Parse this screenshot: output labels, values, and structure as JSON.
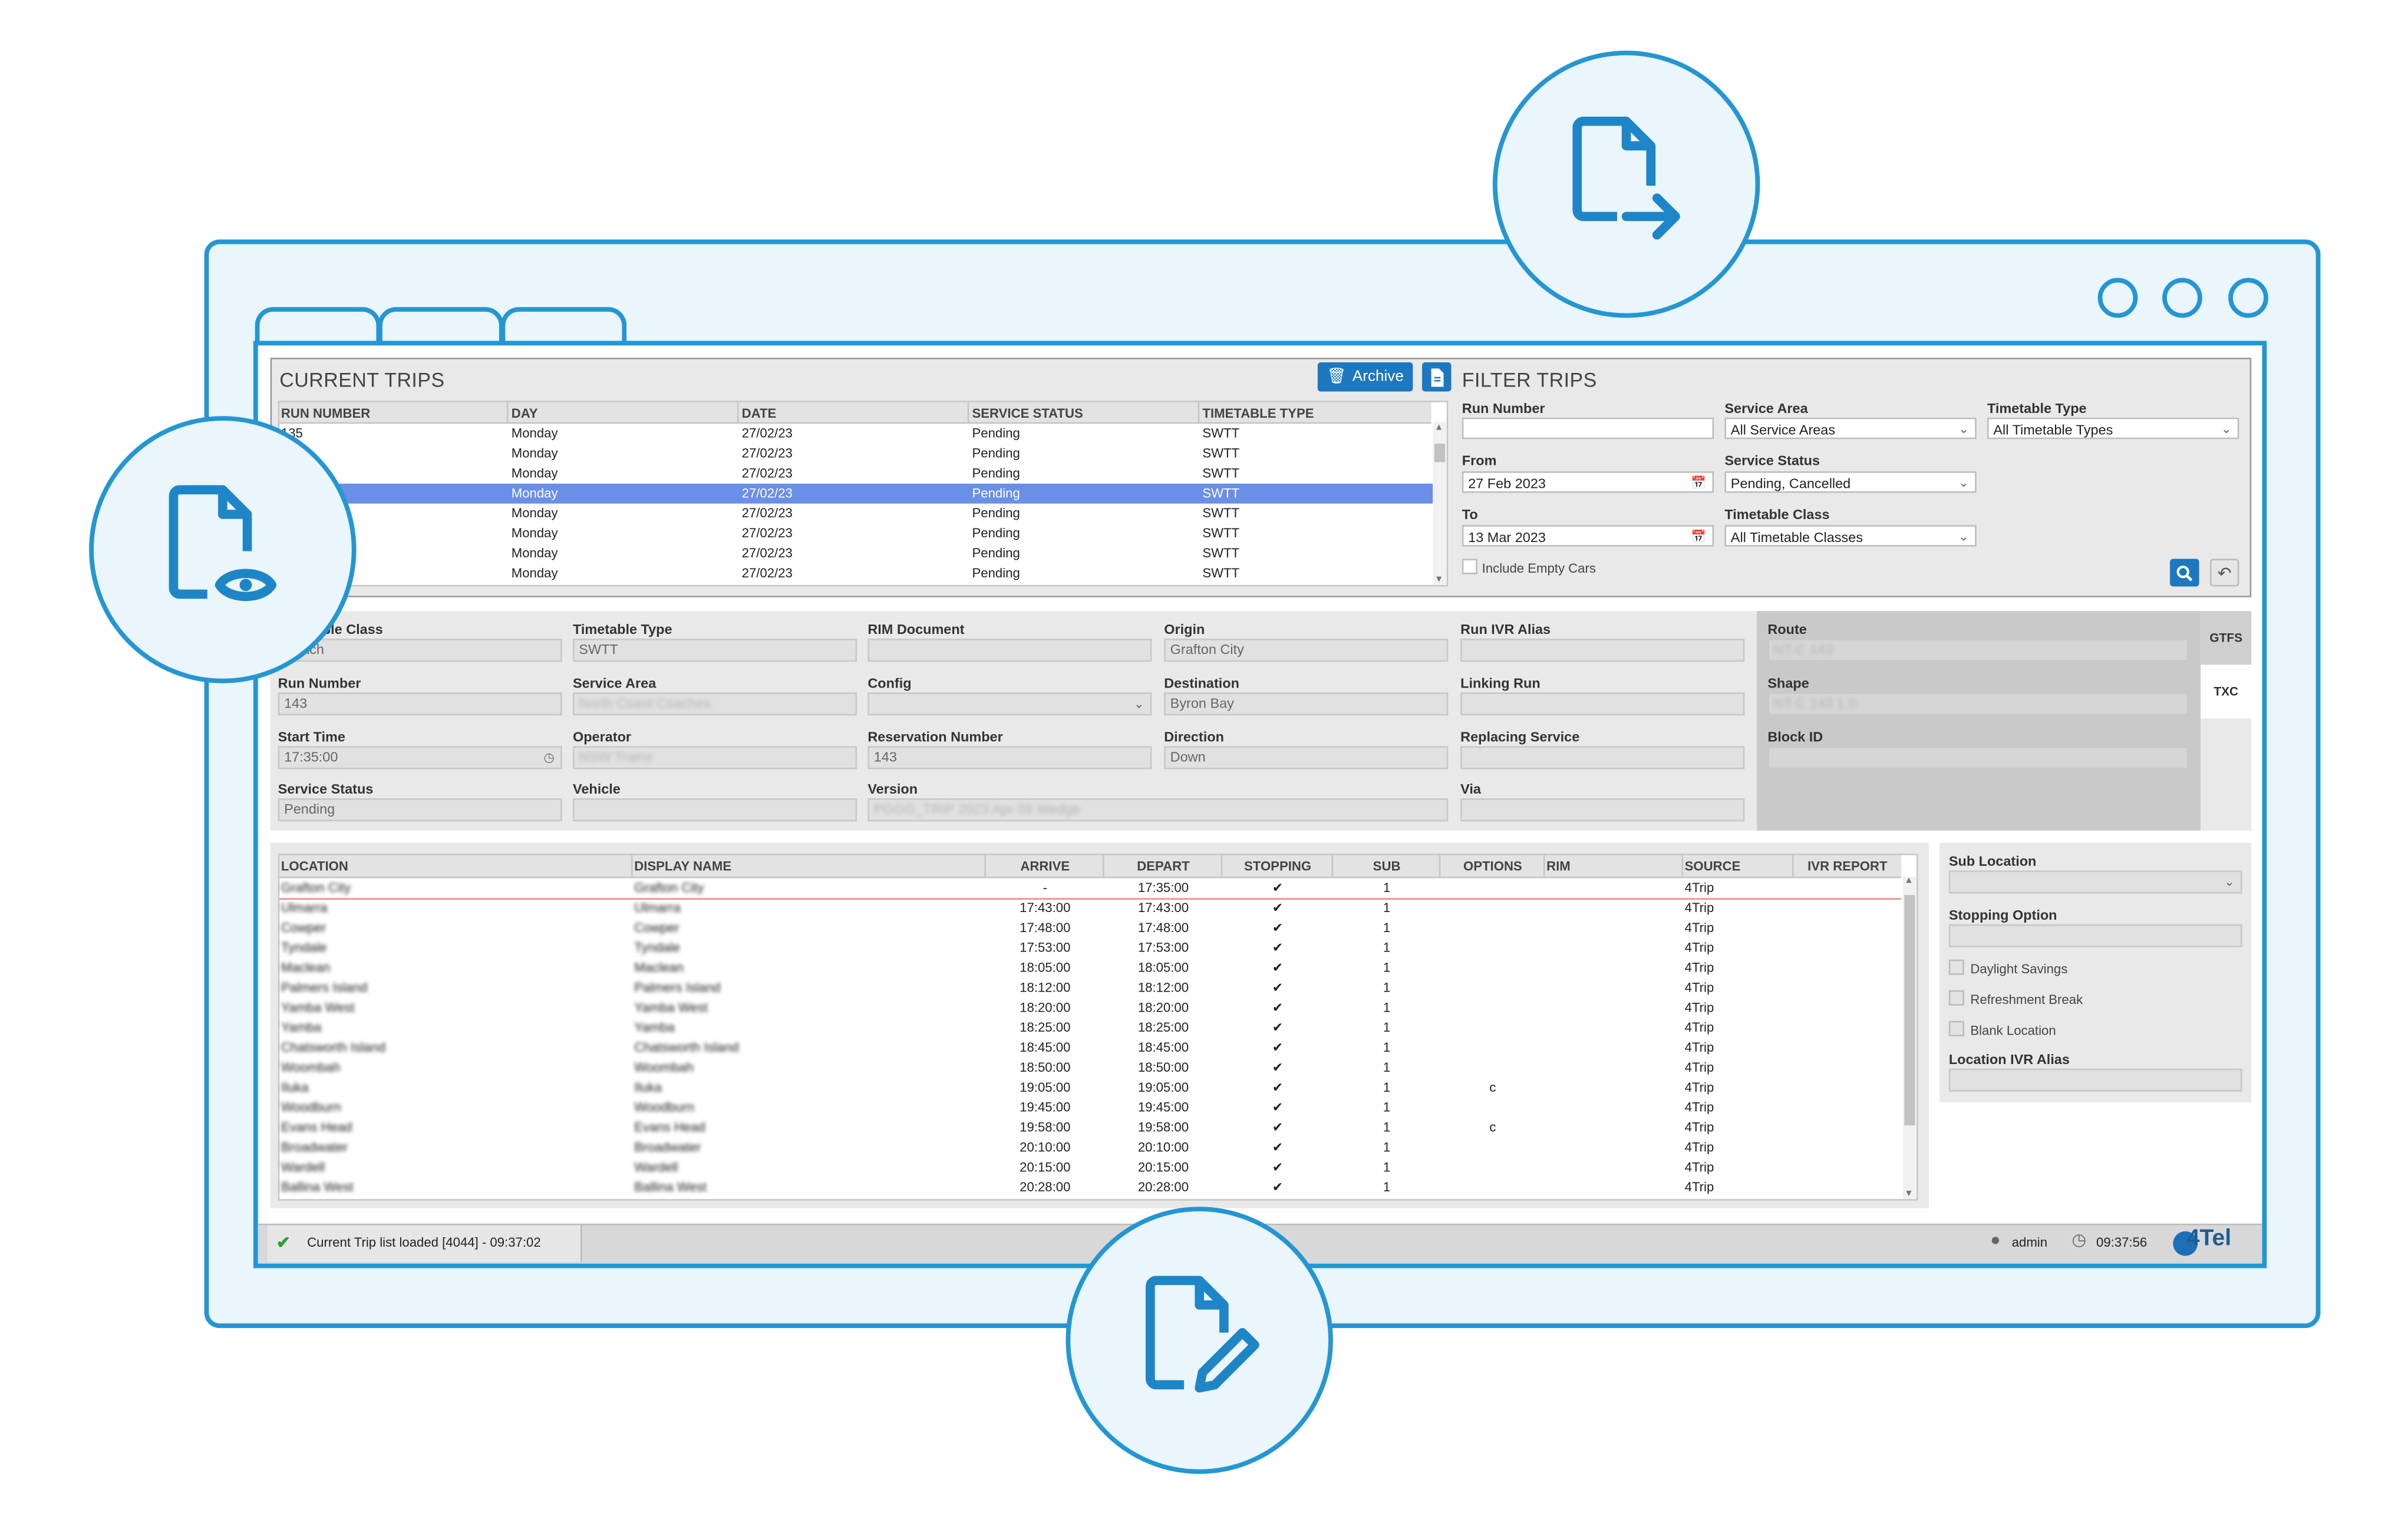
{
  "current_trips": {
    "title": "CURRENT TRIPS",
    "archive_label": "Archive",
    "columns": [
      "RUN NUMBER",
      "DAY",
      "DATE",
      "SERVICE STATUS",
      "TIMETABLE TYPE"
    ],
    "rows": [
      [
        "135",
        "Monday",
        "27/02/23",
        "Pending",
        "SWTT"
      ],
      [
        "",
        "Monday",
        "27/02/23",
        "Pending",
        "SWTT"
      ],
      [
        "",
        "Monday",
        "27/02/23",
        "Pending",
        "SWTT"
      ],
      [
        "",
        "Monday",
        "27/02/23",
        "Pending",
        "SWTT"
      ],
      [
        "",
        "Monday",
        "27/02/23",
        "Pending",
        "SWTT"
      ],
      [
        "",
        "Monday",
        "27/02/23",
        "Pending",
        "SWTT"
      ],
      [
        "",
        "Monday",
        "27/02/23",
        "Pending",
        "SWTT"
      ],
      [
        "",
        "Monday",
        "27/02/23",
        "Pending",
        "SWTT"
      ]
    ],
    "selected_row": 3
  },
  "filter_trips": {
    "title": "FILTER TRIPS",
    "run_number_label": "Run Number",
    "run_number_value": "",
    "from_label": "From",
    "from_value": "27 Feb 2023",
    "to_label": "To",
    "to_value": "13 Mar 2023",
    "include_empty_label": "Include Empty Cars",
    "service_area_label": "Service Area",
    "service_area_value": "All Service Areas",
    "service_status_label": "Service Status",
    "service_status_value": "Pending, Cancelled",
    "timetable_class_label": "Timetable Class",
    "timetable_class_value": "All Timetable Classes",
    "timetable_type_label": "Timetable Type",
    "timetable_type_value": "All Timetable Types"
  },
  "details": {
    "timetable_class_label": "Timetable Class",
    "timetable_class_value": "Coach",
    "run_number_label": "Run Number",
    "run_number_value": "143",
    "start_time_label": "Start Time",
    "start_time_value": "17:35:00",
    "service_status_label": "Service Status",
    "service_status_value": "Pending",
    "timetable_type_label": "Timetable Type",
    "timetable_type_value": "SWTT",
    "service_area_label": "Service Area",
    "service_area_value": "North Coast Coaches",
    "operator_label": "Operator",
    "operator_value": "NSW Trains",
    "vehicle_label": "Vehicle",
    "vehicle_value": "",
    "rim_document_label": "RIM Document",
    "rim_document_value": "",
    "config_label": "Config",
    "config_value": "",
    "reservation_label": "Reservation Number",
    "reservation_value": "143",
    "version_label": "Version",
    "version_value": "PGGG_TRIP 2023 Apr 09 Wedge",
    "origin_label": "Origin",
    "origin_value": "Grafton City",
    "destination_label": "Destination",
    "destination_value": "Byron Bay",
    "direction_label": "Direction",
    "direction_value": "Down",
    "run_ivr_label": "Run IVR Alias",
    "linking_run_label": "Linking Run",
    "replacing_service_label": "Replacing Service",
    "via_label": "Via",
    "route_label": "Route",
    "route_value": "NT-C 143",
    "shape_label": "Shape",
    "shape_value": "NT-C 143 1.0",
    "block_id_label": "Block ID",
    "tab_gtfs": "GTFS",
    "tab_txc": "TXC"
  },
  "stops": {
    "columns": [
      "LOCATION",
      "DISPLAY NAME",
      "ARRIVE",
      "DEPART",
      "STOPPING",
      "SUB",
      "OPTIONS",
      "RIM",
      "SOURCE",
      "IVR REPORT"
    ],
    "rows": [
      {
        "loc": "Grafton City",
        "disp": "Grafton City",
        "arr": "-",
        "dep": "17:35:00",
        "sub": "1",
        "opt": "",
        "src": "4Trip"
      },
      {
        "loc": "Ulmarra",
        "disp": "Ulmarra",
        "arr": "17:43:00",
        "dep": "17:43:00",
        "sub": "1",
        "opt": "",
        "src": "4Trip"
      },
      {
        "loc": "Cowper",
        "disp": "Cowper",
        "arr": "17:48:00",
        "dep": "17:48:00",
        "sub": "1",
        "opt": "",
        "src": "4Trip"
      },
      {
        "loc": "Tyndale",
        "disp": "Tyndale",
        "arr": "17:53:00",
        "dep": "17:53:00",
        "sub": "1",
        "opt": "",
        "src": "4Trip"
      },
      {
        "loc": "Maclean",
        "disp": "Maclean",
        "arr": "18:05:00",
        "dep": "18:05:00",
        "sub": "1",
        "opt": "",
        "src": "4Trip"
      },
      {
        "loc": "Palmers Island",
        "disp": "Palmers Island",
        "arr": "18:12:00",
        "dep": "18:12:00",
        "sub": "1",
        "opt": "",
        "src": "4Trip"
      },
      {
        "loc": "Yamba West",
        "disp": "Yamba West",
        "arr": "18:20:00",
        "dep": "18:20:00",
        "sub": "1",
        "opt": "",
        "src": "4Trip"
      },
      {
        "loc": "Yamba",
        "disp": "Yamba",
        "arr": "18:25:00",
        "dep": "18:25:00",
        "sub": "1",
        "opt": "",
        "src": "4Trip"
      },
      {
        "loc": "Chatsworth Island",
        "disp": "Chatsworth Island",
        "arr": "18:45:00",
        "dep": "18:45:00",
        "sub": "1",
        "opt": "",
        "src": "4Trip"
      },
      {
        "loc": "Woombah",
        "disp": "Woombah",
        "arr": "18:50:00",
        "dep": "18:50:00",
        "sub": "1",
        "opt": "",
        "src": "4Trip"
      },
      {
        "loc": "Iluka",
        "disp": "Iluka",
        "arr": "19:05:00",
        "dep": "19:05:00",
        "sub": "1",
        "opt": "c",
        "src": "4Trip"
      },
      {
        "loc": "Woodburn",
        "disp": "Woodburn",
        "arr": "19:45:00",
        "dep": "19:45:00",
        "sub": "1",
        "opt": "",
        "src": "4Trip"
      },
      {
        "loc": "Evans Head",
        "disp": "Evans Head",
        "arr": "19:58:00",
        "dep": "19:58:00",
        "sub": "1",
        "opt": "c",
        "src": "4Trip"
      },
      {
        "loc": "Broadwater",
        "disp": "Broadwater",
        "arr": "20:10:00",
        "dep": "20:10:00",
        "sub": "1",
        "opt": "",
        "src": "4Trip"
      },
      {
        "loc": "Wardell",
        "disp": "Wardell",
        "arr": "20:15:00",
        "dep": "20:15:00",
        "sub": "1",
        "opt": "",
        "src": "4Trip"
      },
      {
        "loc": "Ballina West",
        "disp": "Ballina West",
        "arr": "20:28:00",
        "dep": "20:28:00",
        "sub": "1",
        "opt": "",
        "src": "4Trip"
      }
    ]
  },
  "side": {
    "sub_location_label": "Sub Location",
    "stopping_option_label": "Stopping Option",
    "daylight_label": "Daylight Savings",
    "refreshment_label": "Refreshment Break",
    "blank_label": "Blank Location",
    "loc_ivr_label": "Location IVR Alias"
  },
  "status": {
    "message": "Current Trip list loaded [4044] - 09:37:02",
    "user": "admin",
    "time": "09:37:56",
    "brand": "4Tel"
  },
  "colors": {
    "accent": "#2496d3",
    "selected_row": "#6a8fe6",
    "button": "#1c78c0",
    "frame_bg": "#eaf5fc"
  },
  "icons": [
    "file-export-icon",
    "file-view-icon",
    "file-edit-icon",
    "archive-icon",
    "document-icon",
    "search-icon",
    "undo-icon",
    "calendar-icon",
    "clock-icon",
    "user-icon",
    "check-icon"
  ]
}
